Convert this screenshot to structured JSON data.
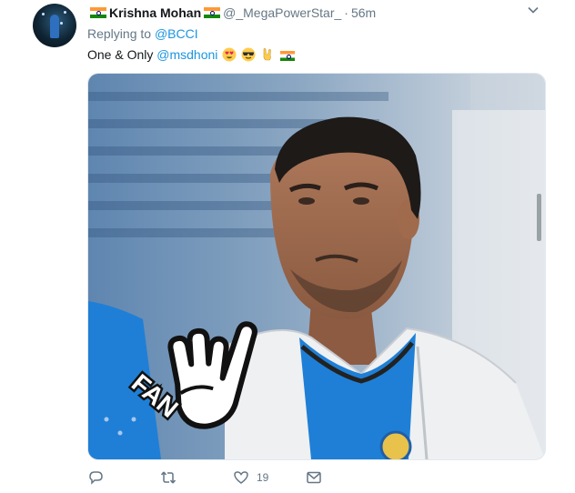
{
  "tweet": {
    "author_name": "Krishna Mohan",
    "handle": "@_MegaPowerStar_",
    "separator": "·",
    "time": "56m",
    "replying_prefix": "Replying to",
    "replying_to": "@BCCI",
    "text_prefix": "One & Only",
    "mention": "@msdhoni",
    "emojis": [
      "heart-eyes-emoji",
      "sunglasses-emoji",
      "rock-hand-emoji",
      "india-flag-emoji"
    ],
    "media_badge": "FAN",
    "like_count": "19"
  },
  "colors": {
    "link": "#1b95e0",
    "muted": "#657786",
    "jersey": "#1f7fd6"
  }
}
